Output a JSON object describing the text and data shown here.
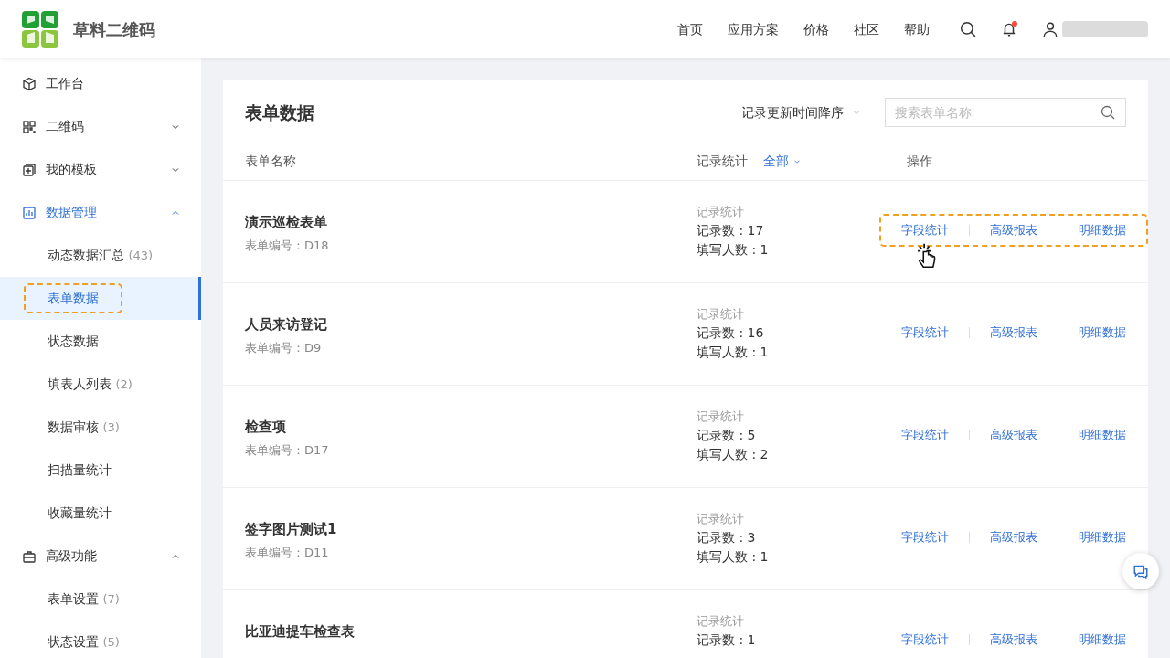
{
  "header": {
    "logo_text": "草料二维码",
    "nav": [
      "首页",
      "应用方案",
      "价格",
      "社区",
      "帮助"
    ],
    "notification_dot": true
  },
  "sidebar": {
    "items": [
      {
        "kind": "link",
        "label": "工作台",
        "selected": false
      },
      {
        "kind": "group",
        "label": "二维码",
        "selected": false,
        "expanded": false
      },
      {
        "kind": "group",
        "label": "我的模板",
        "selected": false,
        "expanded": false
      },
      {
        "kind": "group",
        "label": "数据管理",
        "selected": true,
        "expanded": true,
        "children": [
          {
            "label": "动态数据汇总",
            "count": "(43)",
            "selected": false,
            "highlighted": false
          },
          {
            "label": "表单数据",
            "selected": true,
            "highlighted": true
          },
          {
            "label": "状态数据",
            "selected": false,
            "highlighted": false
          },
          {
            "label": "填表人列表",
            "count": "(2)",
            "selected": false,
            "highlighted": false
          },
          {
            "label": "数据审核",
            "count": "(3)",
            "selected": false,
            "highlighted": false
          },
          {
            "label": "扫描量统计",
            "selected": false,
            "highlighted": false
          },
          {
            "label": "收藏量统计",
            "selected": false,
            "highlighted": false
          }
        ]
      },
      {
        "kind": "group",
        "label": "高级功能",
        "selected": false,
        "expanded": true,
        "children": [
          {
            "label": "表单设置",
            "count": "(7)",
            "selected": false,
            "highlighted": false
          },
          {
            "label": "状态设置",
            "count": "(5)",
            "selected": false,
            "highlighted": false
          }
        ]
      }
    ]
  },
  "main": {
    "title": "表单数据",
    "sort": "记录更新时间降序",
    "search": {
      "placeholder": "搜索表单名称"
    },
    "columns": [
      {
        "label": "表单名称"
      },
      {
        "label": "记录统计",
        "filter": "全部"
      },
      {
        "label": "操作"
      }
    ],
    "rows": [
      {
        "name": "演示巡检表单",
        "code": "表单编号：D18",
        "stats_label": "记录统计",
        "records": "记录数 : 17",
        "fillers": "填写人数 : 1",
        "actions": [
          "字段统计",
          "高级报表",
          "明细数据"
        ],
        "highlighted": true,
        "cursor": true
      },
      {
        "name": "人员来访登记",
        "code": "表单编号：D9",
        "stats_label": "记录统计",
        "records": "记录数 : 16",
        "fillers": "填写人数 : 1",
        "actions": [
          "字段统计",
          "高级报表",
          "明细数据"
        ],
        "highlighted": false,
        "cursor": false
      },
      {
        "name": "检查项",
        "code": "表单编号：D17",
        "stats_label": "记录统计",
        "records": "记录数 : 5",
        "fillers": "填写人数 : 2",
        "actions": [
          "字段统计",
          "高级报表",
          "明细数据"
        ],
        "highlighted": false,
        "cursor": false
      },
      {
        "name": "签字图片测试1",
        "code": "表单编号：D11",
        "stats_label": "记录统计",
        "records": "记录数 : 3",
        "fillers": "填写人数 : 1",
        "actions": [
          "字段统计",
          "高级报表",
          "明细数据"
        ],
        "highlighted": false,
        "cursor": false
      },
      {
        "name": "比亚迪提车检查表",
        "stats_label": "记录统计",
        "records": "记录数 : 1",
        "actions": [
          "字段统计",
          "高级报表",
          "明细数据"
        ],
        "highlighted": false,
        "cursor": false
      }
    ]
  }
}
